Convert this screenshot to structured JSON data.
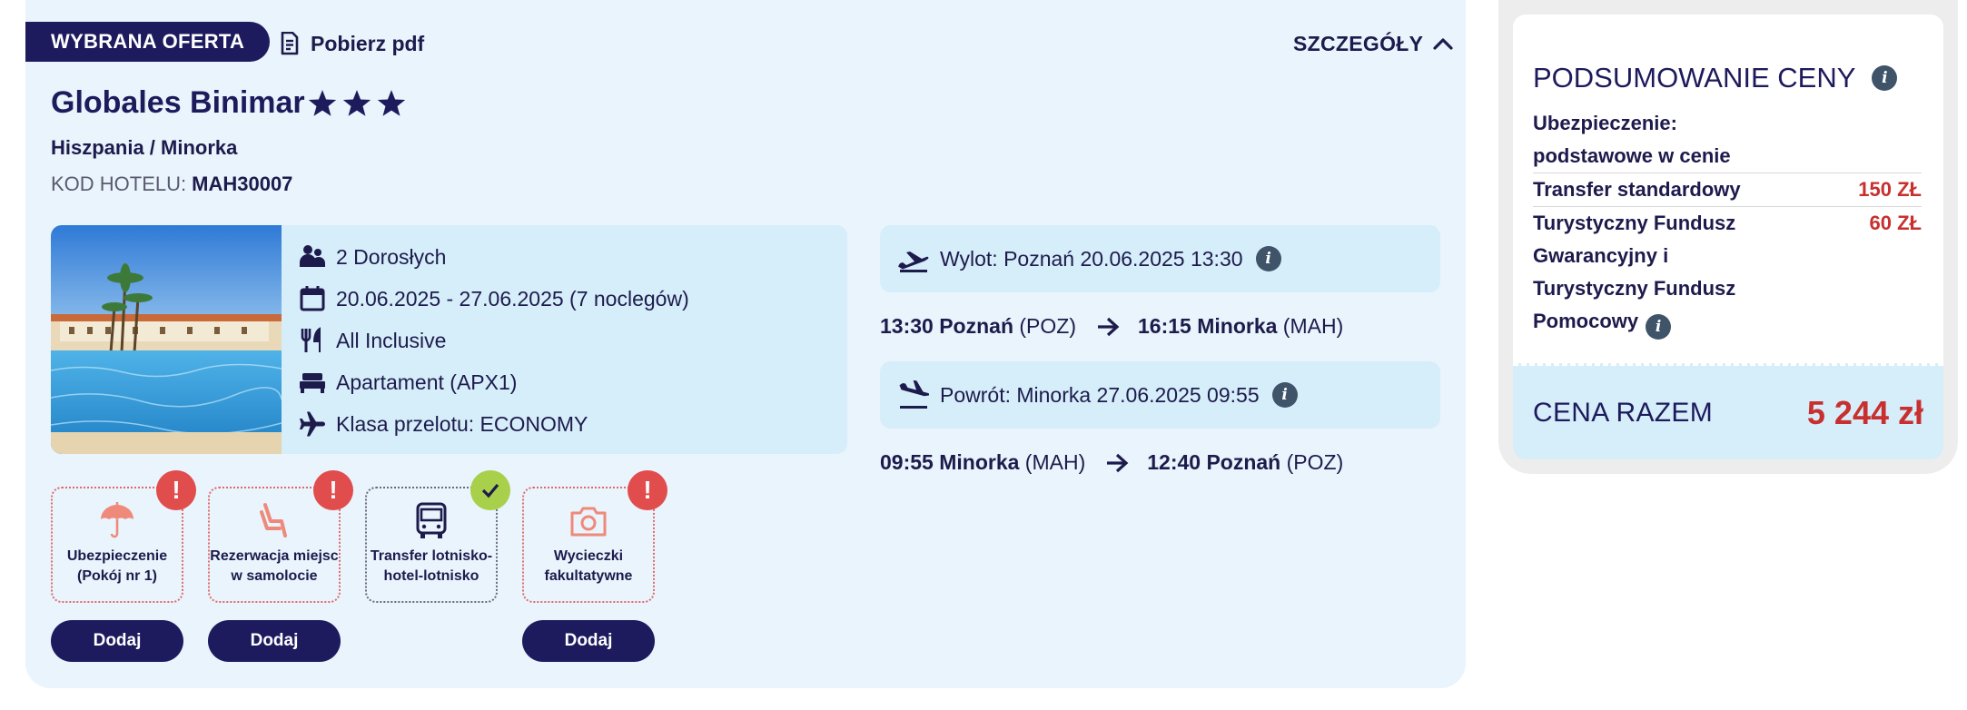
{
  "offer": {
    "badge": "WYBRANA OFERTA",
    "pdf_label": "Pobierz pdf",
    "details_label": "SZCZEGÓŁY",
    "hotel_name": "Globales Binimar",
    "stars": 3,
    "location": "Hiszpania / Minorka",
    "hotel_code_label": "KOD HOTELU:",
    "hotel_code": "MAH30007",
    "info": {
      "travelers": "2 Dorosłych",
      "dates": "20.06.2025 - 27.06.2025 (7 noclegów)",
      "board": "All Inclusive",
      "room": "Apartament (APX1)",
      "flight_class": "Klasa przelotu: ECONOMY"
    }
  },
  "flights": {
    "outbound": {
      "label": "Wylot: Poznań 20.06.2025 13:30",
      "dep_time": "13:30",
      "dep_city": "Poznań",
      "dep_code": "(POZ)",
      "arr_time": "16:15",
      "arr_city": "Minorka",
      "arr_code": "(MAH)"
    },
    "return": {
      "label": "Powrót: Minorka 27.06.2025 09:55",
      "dep_time": "09:55",
      "dep_city": "Minorka",
      "dep_code": "(MAH)",
      "arr_time": "12:40",
      "arr_city": "Poznań",
      "arr_code": "(POZ)"
    }
  },
  "addons": [
    {
      "label_line1": "Ubezpieczenie",
      "label_line2": "(Pokój nr 1)",
      "status": "warning",
      "icon": "umbrella-icon",
      "button": "Dodaj"
    },
    {
      "label_line1": "Rezerwacja miejsc",
      "label_line2": "w samolocie",
      "status": "warning",
      "icon": "seat-icon",
      "button": "Dodaj"
    },
    {
      "label_line1": "Transfer lotnisko-",
      "label_line2": "hotel-lotnisko",
      "status": "ok",
      "icon": "bus-icon",
      "button": ""
    },
    {
      "label_line1": "Wycieczki",
      "label_line2": "fakultatywne",
      "status": "warning",
      "icon": "camera-icon",
      "button": "Dodaj"
    }
  ],
  "price_summary": {
    "title": "PODSUMOWANIE CENY",
    "insurance_line1": "Ubezpieczenie:",
    "insurance_line2": "podstawowe w cenie",
    "transfer_label": "Transfer standardowy",
    "transfer_price": "150 ZŁ",
    "fund_line1": "Turystyczny Fundusz",
    "fund_line2": "Gwarancyjny i",
    "fund_line3": "Turystyczny Fundusz",
    "fund_line4": "Pomocowy",
    "fund_price": "60 ZŁ",
    "total_label": "CENA RAZEM",
    "total_value": "5 244 zł"
  },
  "colors": {
    "navy": "#1d1b5e",
    "panel": "#d6edfa",
    "card": "#e9f4fc",
    "price_red": "#c7302f",
    "warning_red": "#e14c4c",
    "ok_green": "#a8d04a",
    "addon_icon": "#ef8a7a"
  }
}
